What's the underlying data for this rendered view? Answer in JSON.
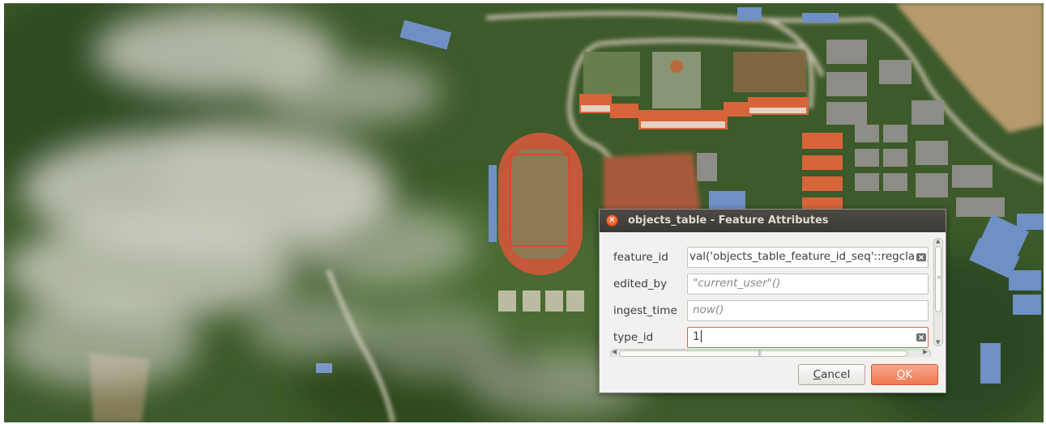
{
  "dialog": {
    "title": "objects_table - Feature Attributes",
    "fields": [
      {
        "label": "feature_id",
        "value": "val('objects_table_feature_id_seq'::regclass)",
        "placeholder": ""
      },
      {
        "label": "edited_by",
        "value": "",
        "placeholder": "\"current_user\"()"
      },
      {
        "label": "ingest_time",
        "value": "",
        "placeholder": "now()"
      },
      {
        "label": "type_id",
        "value": "1",
        "placeholder": ""
      }
    ],
    "buttons": {
      "cancel_mnemonic": "C",
      "cancel_rest": "ancel",
      "ok_mnemonic": "O",
      "ok_rest": "K"
    }
  },
  "colors": {
    "titlebar": "#3c3b37",
    "close_button": "#e8592b",
    "ok_button": "#f08a63",
    "active_field_border": "#e0613a"
  },
  "icons": {
    "close": "close-icon",
    "clear": "clear-field-icon"
  }
}
